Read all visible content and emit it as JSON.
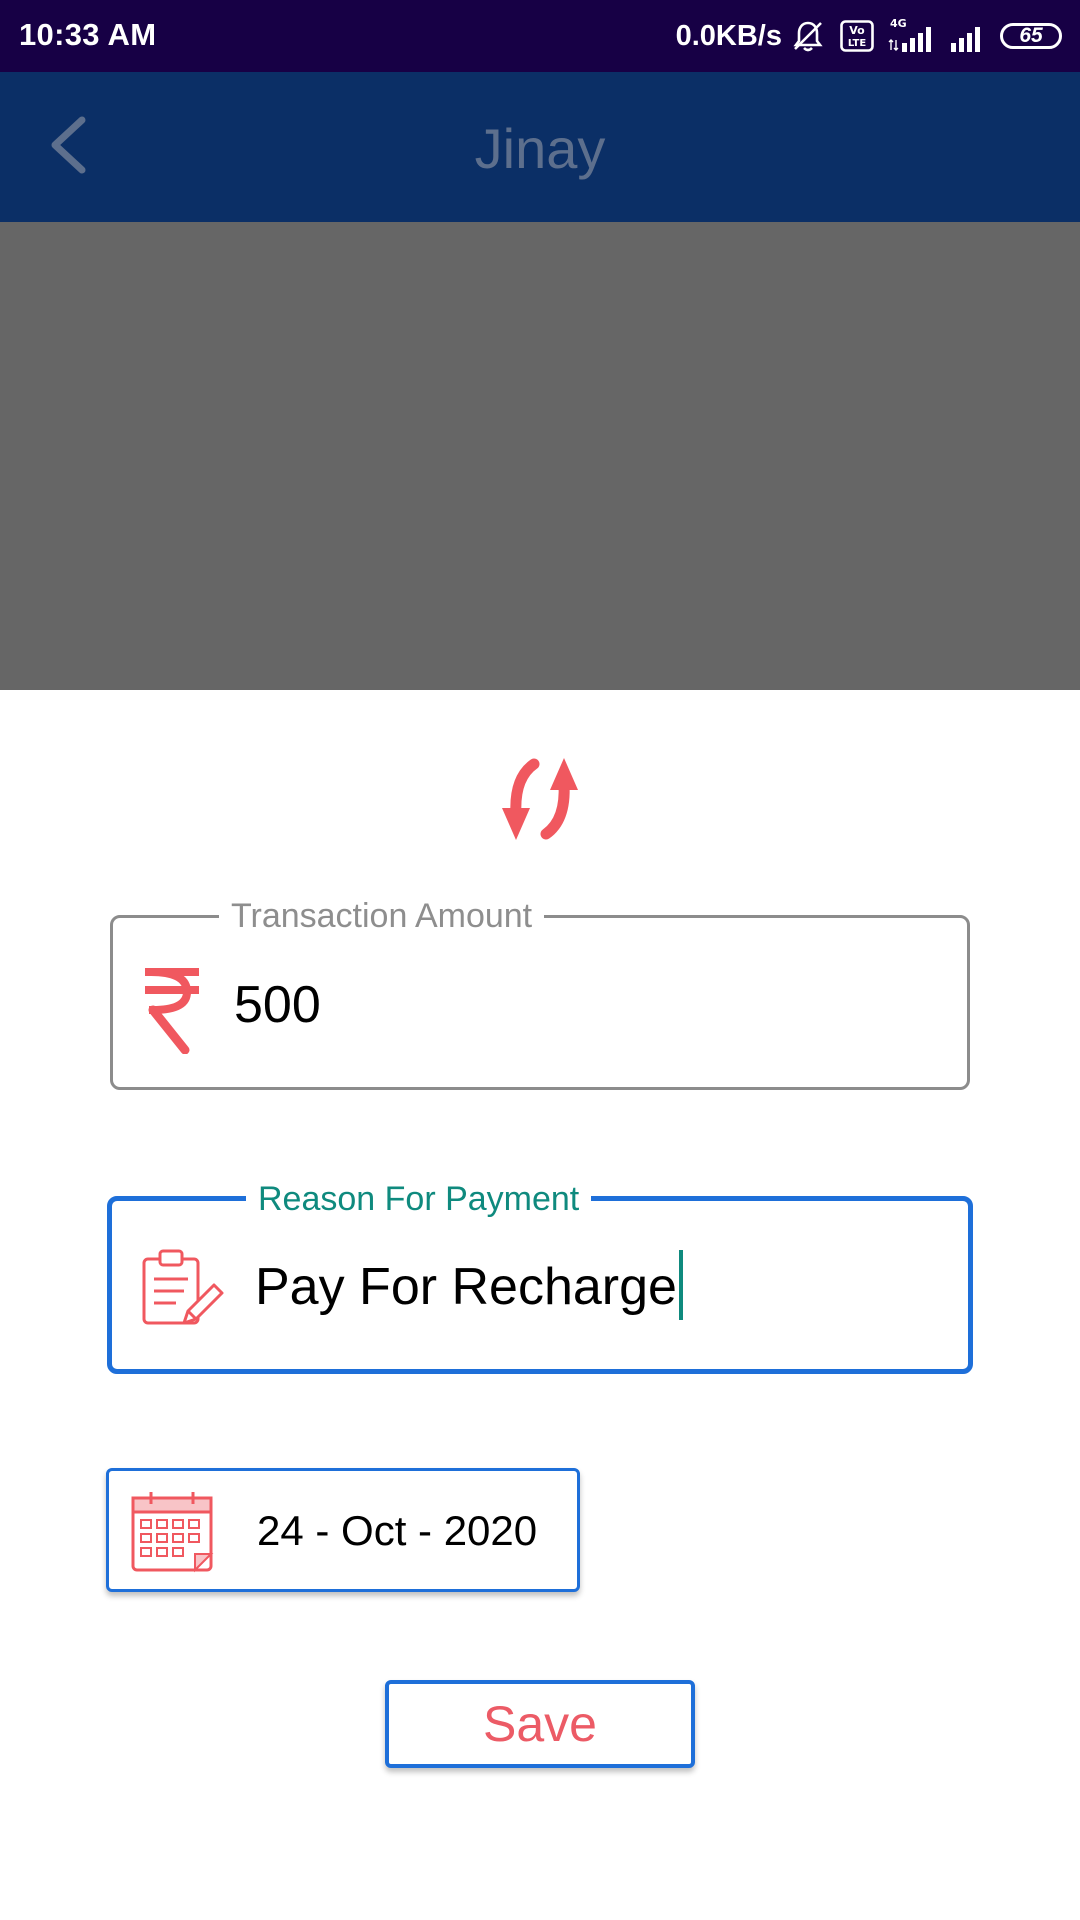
{
  "status_bar": {
    "time": "10:33 AM",
    "net_speed": "0.0KB/s",
    "network_type": "4G",
    "volte": "Vo LTE",
    "battery": "65",
    "icons": [
      "bell-off-icon",
      "volte-icon",
      "signal-4g-icon",
      "signal-icon",
      "battery-icon"
    ]
  },
  "app_bar": {
    "title": "Jinay",
    "back_icon": "chevron-left-icon"
  },
  "form": {
    "header_icon": "sync-arrows-icon",
    "amount": {
      "label": "Transaction Amount",
      "value": "500",
      "icon": "rupee-icon"
    },
    "reason": {
      "label": "Reason For Payment",
      "value": "Pay For Recharge",
      "icon": "clipboard-edit-icon"
    },
    "date": {
      "value": "24 - Oct - 2020",
      "icon": "calendar-icon"
    },
    "save_label": "Save"
  },
  "colors": {
    "status_bar": "#170045",
    "app_bar": "#0b2f66",
    "scrim": "#666666",
    "accent_blue": "#1e6fd9",
    "accent_red": "#ec5b66",
    "focus_teal": "#0f8a7e"
  }
}
